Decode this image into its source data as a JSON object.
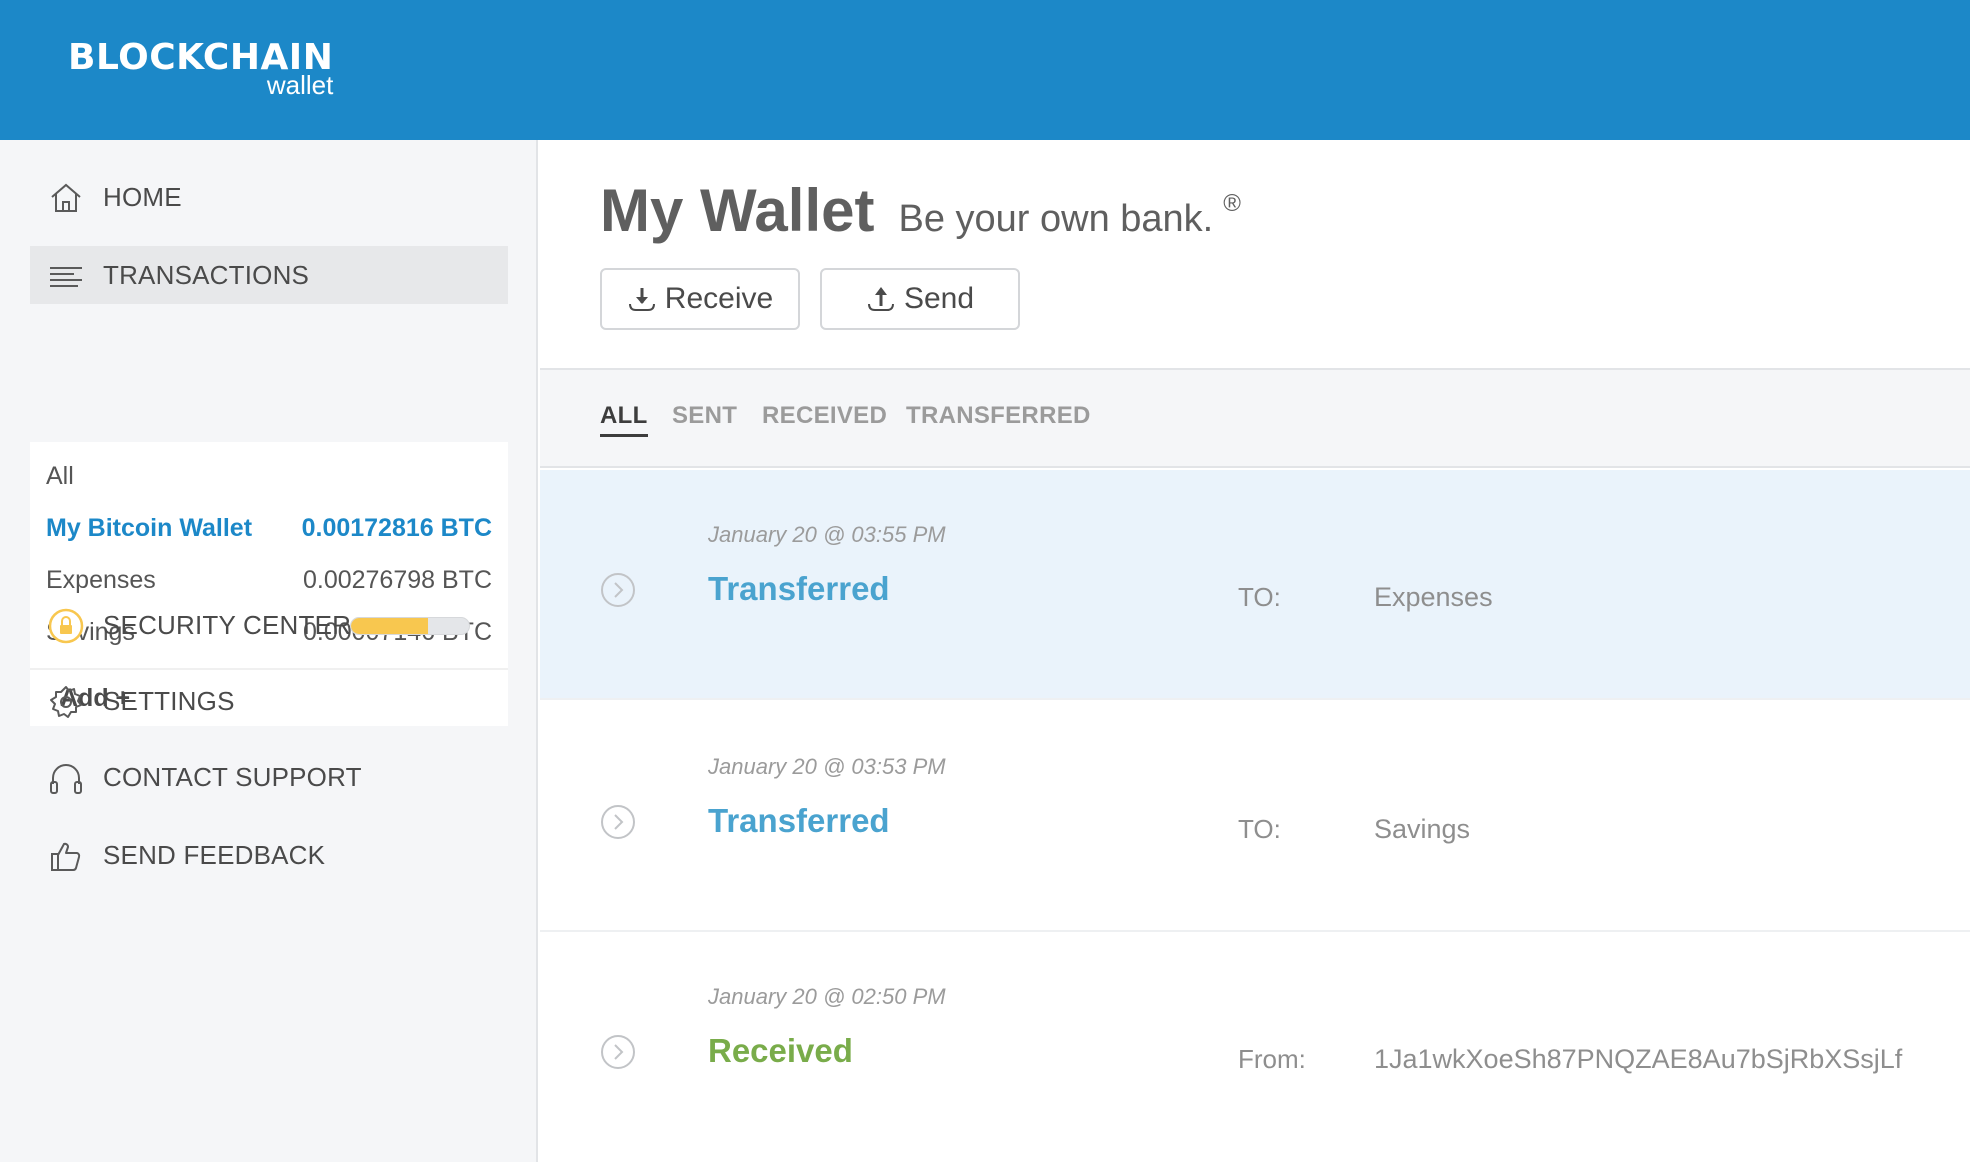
{
  "header": {
    "brand": "BLOCKCHAIN",
    "sub": "wallet",
    "bg_color": "#1c88c8"
  },
  "sidebar": {
    "items": [
      {
        "label": "HOME",
        "icon": "home-icon"
      },
      {
        "label": "TRANSACTIONS",
        "icon": "list-icon"
      },
      {
        "label": "SECURITY CENTER",
        "icon": "lock-icon"
      },
      {
        "label": "SETTINGS",
        "icon": "gear-icon"
      },
      {
        "label": "CONTACT SUPPORT",
        "icon": "headphones-icon"
      },
      {
        "label": "SEND FEEDBACK",
        "icon": "thumbs-up-icon"
      }
    ],
    "wallets": [
      {
        "name": "All",
        "amount": ""
      },
      {
        "name": "My Bitcoin Wallet",
        "amount": "0.00172816 BTC"
      },
      {
        "name": "Expenses",
        "amount": "0.00276798 BTC"
      },
      {
        "name": "Savings",
        "amount": "0.00007146 BTC"
      }
    ],
    "add_label": "Add +",
    "security_progress": 0.65,
    "security_color": "#f8c74f"
  },
  "main": {
    "title": "My Wallet",
    "tagline": "Be your own bank.",
    "reg_mark": "®",
    "receive_label": "Receive",
    "send_label": "Send",
    "tabs": [
      "ALL",
      "SENT",
      "RECEIVED",
      "TRANSFERRED"
    ],
    "active_tab": "ALL",
    "transactions": [
      {
        "date": "January 20 @ 03:55 PM",
        "type": "Transferred",
        "direction": "TO:",
        "counterparty": "Expenses"
      },
      {
        "date": "January 20 @ 03:53 PM",
        "type": "Transferred",
        "direction": "TO:",
        "counterparty": "Savings"
      },
      {
        "date": "January 20 @ 02:50 PM",
        "type": "Received",
        "direction": "From:",
        "counterparty": "1Ja1wkXoeSh87PNQZAE8Au7bSjRbXSsjLf"
      }
    ],
    "colors": {
      "transferred": "#4aa3cf",
      "received": "#79ac4a",
      "selected_wallet": "#1c88c8"
    }
  }
}
